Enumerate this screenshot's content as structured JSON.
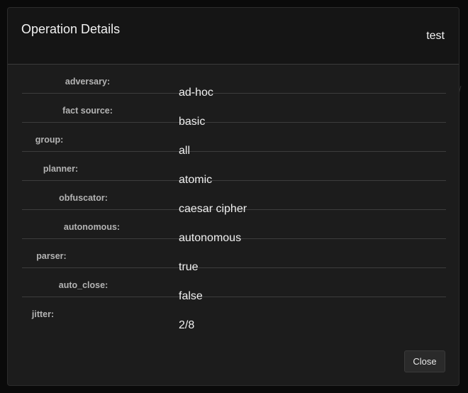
{
  "modal": {
    "title": "Operation Details",
    "operation_name": "test",
    "close_label": "Close"
  },
  "details": [
    {
      "label": "adversary:",
      "value": "ad-hoc"
    },
    {
      "label": "fact source:",
      "value": "basic"
    },
    {
      "label": "group:",
      "value": "all"
    },
    {
      "label": "planner:",
      "value": "atomic"
    },
    {
      "label": "obfuscator:",
      "value": "caesar cipher"
    },
    {
      "label": "autonomous:",
      "value": "autonomous"
    },
    {
      "label": "parser:",
      "value": "true"
    },
    {
      "label": "auto_close:",
      "value": "false"
    },
    {
      "label": "jitter:",
      "value": "2/8"
    }
  ],
  "background": {
    "glyph": "'/"
  }
}
